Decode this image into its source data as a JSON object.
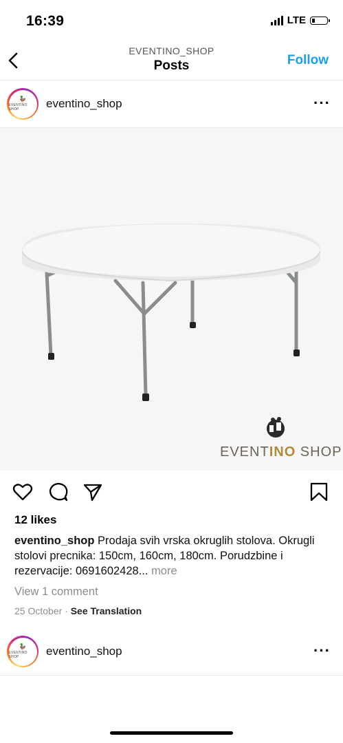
{
  "status_bar": {
    "time": "16:39",
    "network": "LTE",
    "battery_level": 0.15
  },
  "header": {
    "subtitle": "EVENTINO_SHOP",
    "title": "Posts",
    "follow_label": "Follow"
  },
  "post": {
    "username": "eventino_shop",
    "avatar_text": "EVENTINO SHOP",
    "image_brand": {
      "prefix": "EVENT",
      "highlight": "INO",
      "suffix": " SHOP"
    },
    "likes": "12 likes",
    "caption_user": "eventino_shop",
    "caption_text": "Prodaja svih vrska okruglih stolova. Okrugli stolovi precnika: 150cm, 160cm, 180cm. Porudzbine i rezervacije: 0691602428...",
    "caption_more": "more",
    "view_comments": "View 1 comment",
    "date": "25 October",
    "separator": "·",
    "see_translation": "See Translation"
  },
  "next_post": {
    "username": "eventino_shop"
  },
  "icons": {
    "back": "chevron-left-icon",
    "like": "heart-icon",
    "comment": "comment-icon",
    "share": "send-icon",
    "save": "bookmark-icon",
    "options": "more-dots-icon"
  },
  "colors": {
    "accent": "#1aa0ed",
    "muted": "#8e8e8e",
    "brand_gold": "#b08c3a"
  }
}
